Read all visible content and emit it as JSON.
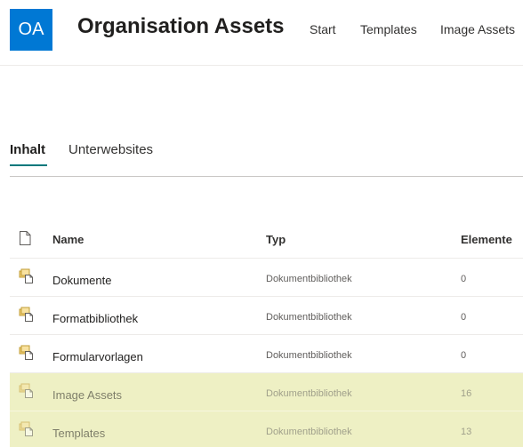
{
  "site": {
    "logo_initials": "OA",
    "title": "Organisation Assets",
    "colors": {
      "logo_bg": "#0078d4",
      "pivot_accent": "#03787c",
      "highlight": "#eef0c4"
    }
  },
  "nav": {
    "start": "Start",
    "templates": "Templates",
    "image_assets": "Image Assets"
  },
  "pivots": {
    "inhalt": "Inhalt",
    "unterwebsites": "Unterwebsites",
    "selected": "Inhalt"
  },
  "list": {
    "headers": {
      "icon": "file-icon",
      "name": "Name",
      "typ": "Typ",
      "elemente": "Elemente"
    },
    "rows": [
      {
        "name": "Dokumente",
        "typ": "Dokumentbibliothek",
        "elemente": "0",
        "icon": "document-library-icon",
        "highlighted": false
      },
      {
        "name": "Formatbibliothek",
        "typ": "Dokumentbibliothek",
        "elemente": "0",
        "icon": "document-library-icon",
        "highlighted": false
      },
      {
        "name": "Formularvorlagen",
        "typ": "Dokumentbibliothek",
        "elemente": "0",
        "icon": "document-library-icon",
        "highlighted": false
      },
      {
        "name": "Image Assets",
        "typ": "Dokumentbibliothek",
        "elemente": "16",
        "icon": "document-library-icon",
        "highlighted": true
      },
      {
        "name": "Templates",
        "typ": "Dokumentbibliothek",
        "elemente": "13",
        "icon": "document-library-icon",
        "highlighted": true
      }
    ]
  }
}
